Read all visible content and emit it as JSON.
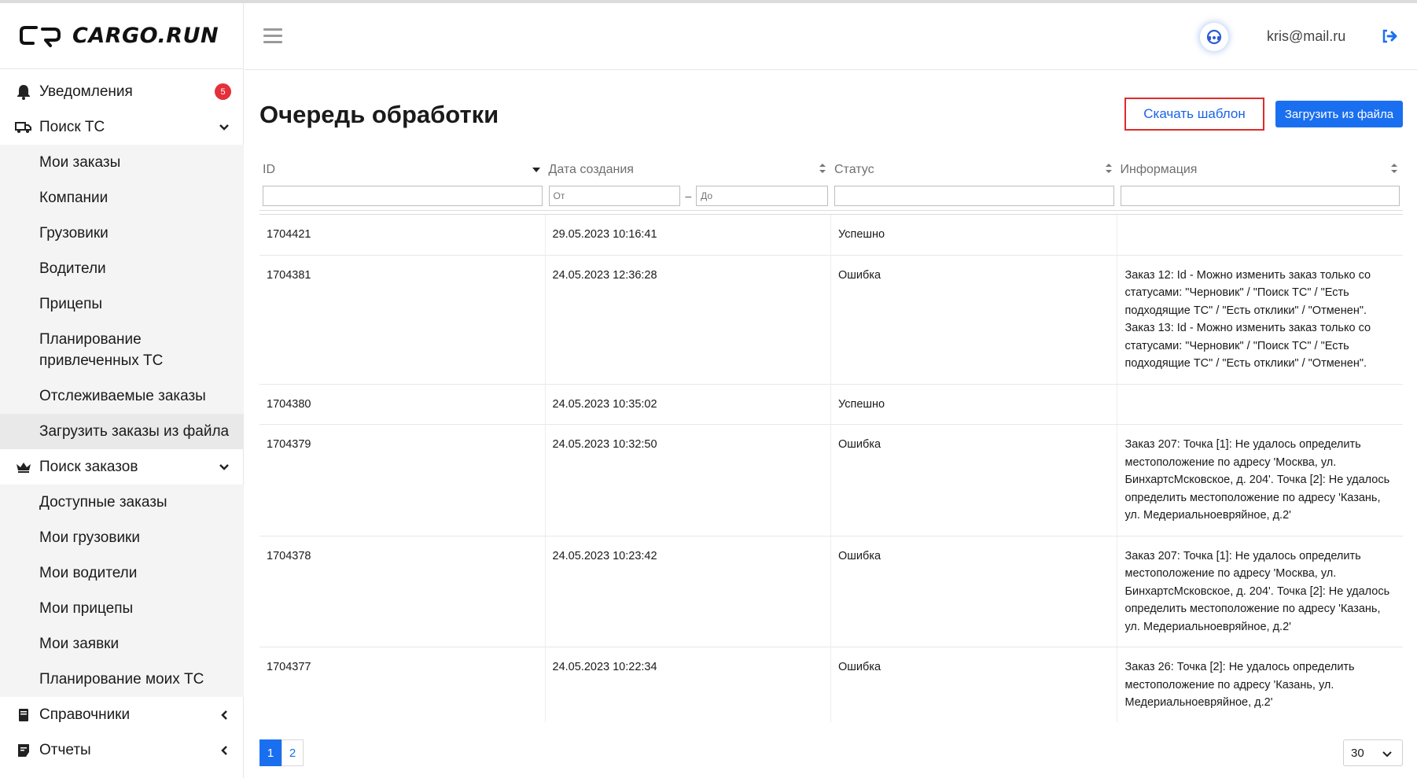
{
  "brand": {
    "name": "CARGO.RUN"
  },
  "header": {
    "user_email": "kris@mail.ru"
  },
  "sidebar": {
    "notifications": {
      "label": "Уведомления",
      "badge": "5"
    },
    "search_vehicles": {
      "label": "Поиск ТС",
      "items": [
        {
          "label": "Мои заказы"
        },
        {
          "label": "Компании"
        },
        {
          "label": "Грузовики"
        },
        {
          "label": "Водители"
        },
        {
          "label": "Прицепы"
        },
        {
          "label": "Планирование привлеченных ТС"
        },
        {
          "label": "Отслеживаемые заказы"
        },
        {
          "label": "Загрузить заказы из файла"
        }
      ]
    },
    "search_orders": {
      "label": "Поиск заказов",
      "items": [
        {
          "label": "Доступные заказы"
        },
        {
          "label": "Мои грузовики"
        },
        {
          "label": "Мои водители"
        },
        {
          "label": "Мои прицепы"
        },
        {
          "label": "Мои заявки"
        },
        {
          "label": "Планирование моих ТС"
        }
      ]
    },
    "references": {
      "label": "Справочники"
    },
    "reports": {
      "label": "Отчеты"
    }
  },
  "main": {
    "title": "Очередь обработки",
    "download_template": "Скачать шаблон",
    "upload_from_file": "Загрузить из файла",
    "columns": [
      "ID",
      "Дата создания",
      "Статус",
      "Информация"
    ],
    "filters": {
      "date_from_placeholder": "От",
      "date_to_placeholder": "До"
    },
    "rows": [
      {
        "id": "1704421",
        "date": "29.05.2023 10:16:41",
        "status": "Успешно",
        "info": ""
      },
      {
        "id": "1704381",
        "date": "24.05.2023 12:36:28",
        "status": "Ошибка",
        "info": "Заказ 12: Id - Можно изменить заказ только со статусами: \"Черновик\" / \"Поиск ТС\" / \"Есть подходящие ТС\" / \"Есть отклики\" / \"Отменен\". Заказ 13: Id - Можно изменить заказ только со статусами: \"Черновик\" / \"Поиск ТС\" / \"Есть подходящие ТС\" / \"Есть отклики\" / \"Отменен\"."
      },
      {
        "id": "1704380",
        "date": "24.05.2023 10:35:02",
        "status": "Успешно",
        "info": ""
      },
      {
        "id": "1704379",
        "date": "24.05.2023 10:32:50",
        "status": "Ошибка",
        "info": "Заказ 207: Точка [1]: Не удалось определить местоположение по адресу 'Москва, ул. БинхартсМсковское, д. 204'. Точка [2]: Не удалось определить местоположение по адресу 'Казань, ул. Медериальноевряйное, д.2'"
      },
      {
        "id": "1704378",
        "date": "24.05.2023 10:23:42",
        "status": "Ошибка",
        "info": "Заказ 207: Точка [1]: Не удалось определить местоположение по адресу 'Москва, ул. БинхартсМсковское, д. 204'. Точка [2]: Не удалось определить местоположение по адресу 'Казань, ул. Медериальноевряйное, д.2'"
      },
      {
        "id": "1704377",
        "date": "24.05.2023 10:22:34",
        "status": "Ошибка",
        "info": "Заказ 26: Точка [2]: Не удалось определить местоположение по адресу 'Казань, ул. Медериальноевряйное, д.2'"
      }
    ],
    "pagination": {
      "pages": [
        "1",
        "2"
      ],
      "current": "1",
      "per_page": "30"
    }
  },
  "colors": {
    "accent": "#1a6ff0",
    "badge": "#e3303b",
    "outline_button_border": "#e02b2b"
  }
}
